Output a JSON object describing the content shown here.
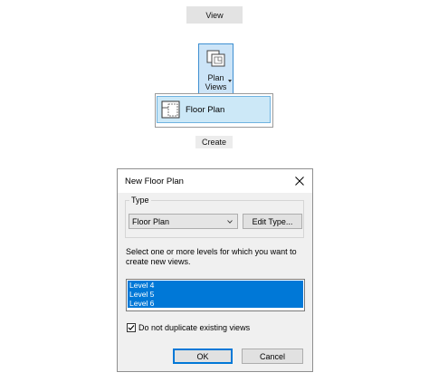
{
  "ribbon": {
    "tab_label": "View",
    "plan_views_label_line1": "Plan",
    "plan_views_label_line2": "Views",
    "dropdown_item_label": "Floor Plan",
    "panel_label": "Create",
    "plan_views_icon": "plan-views-icon",
    "floor_plan_icon": "floor-plan-icon"
  },
  "dialog": {
    "title": "New Floor Plan",
    "close_icon": "close-icon",
    "type_group_label": "Type",
    "type_selected": "Floor Plan",
    "edit_type_label": "Edit Type...",
    "instructions": "Select one or more levels for which you want to create new views.",
    "levels": [
      "Level 4",
      "Level 5",
      "Level 6"
    ],
    "levels_selected": [
      "Level 4",
      "Level 5",
      "Level 6"
    ],
    "dup_checkbox_label": "Do not duplicate existing views",
    "dup_checked": true,
    "ok_label": "OK",
    "cancel_label": "Cancel"
  },
  "colors": {
    "selection_blue": "#0078d7",
    "hover_blue": "#cce4f7",
    "dialog_bg": "#f0f0f0"
  }
}
